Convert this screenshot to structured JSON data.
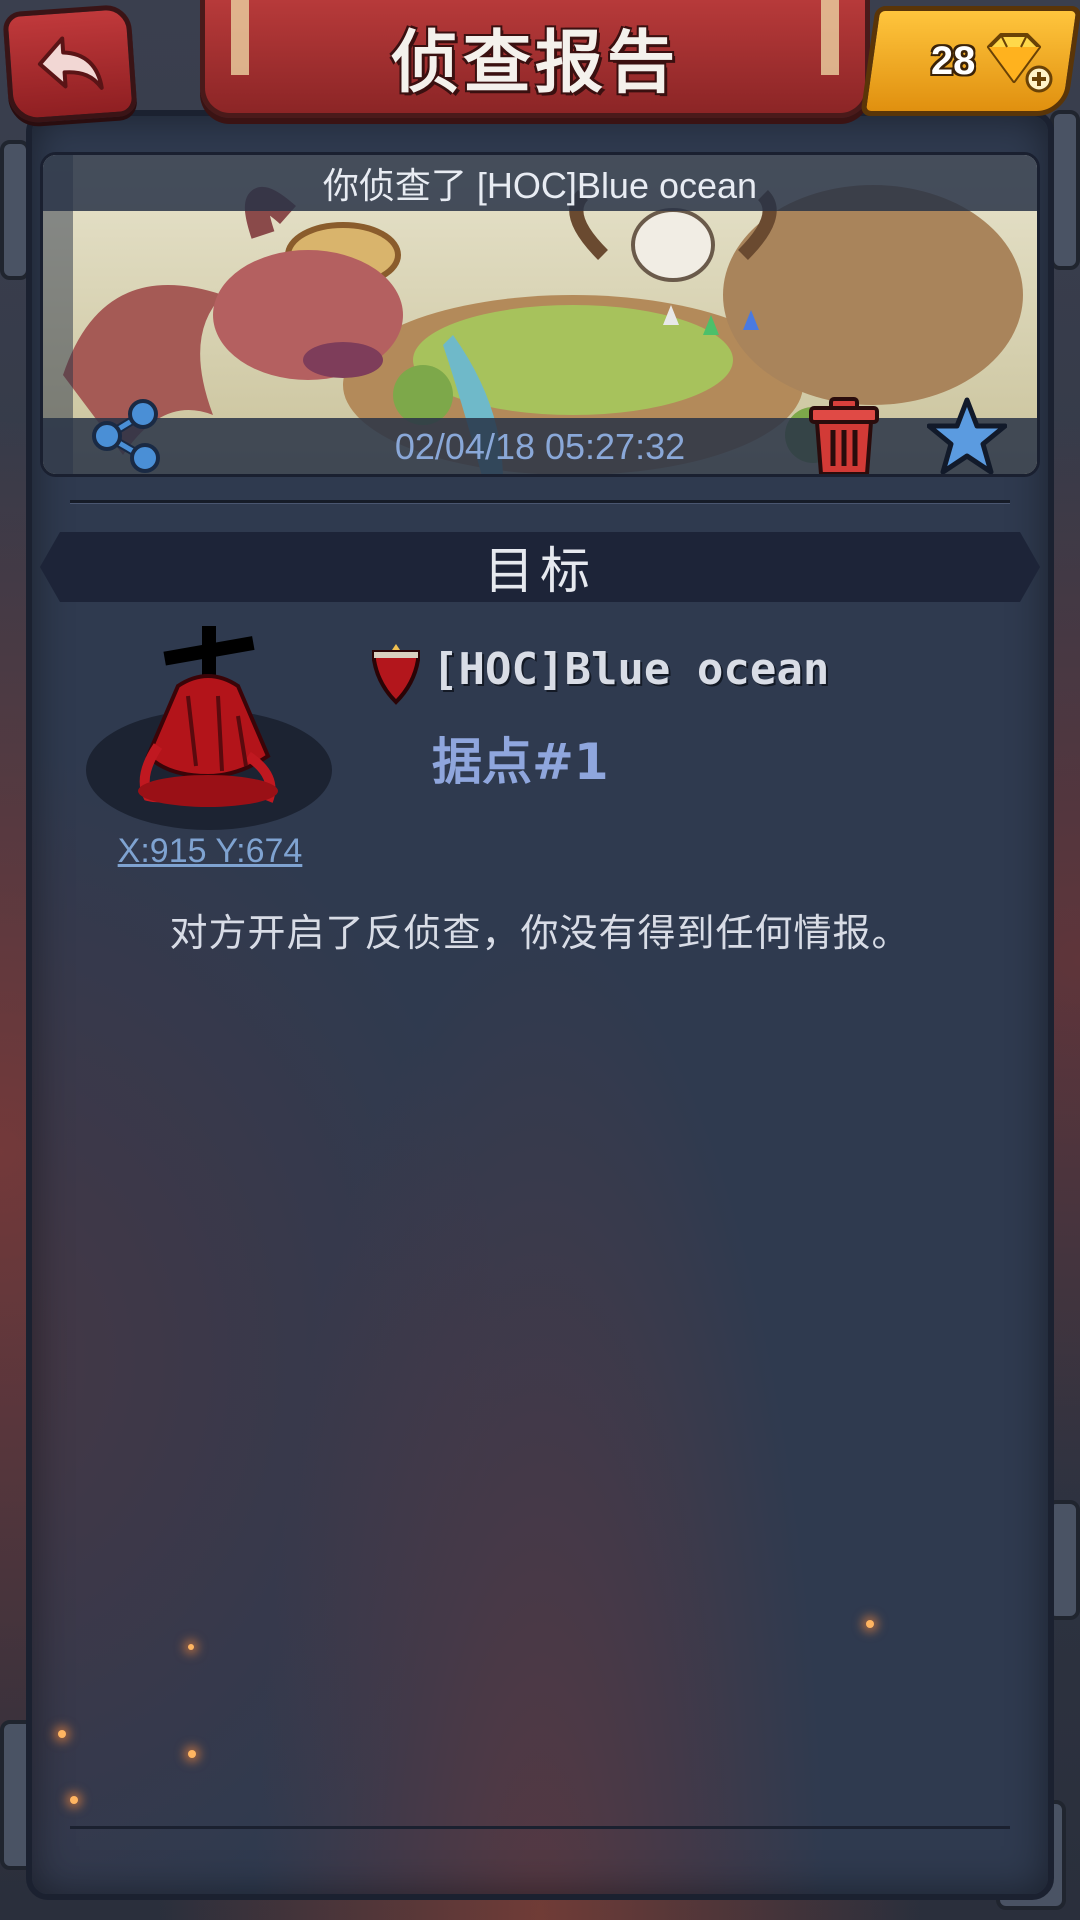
{
  "header": {
    "title": "侦查报告",
    "gems": "28"
  },
  "report": {
    "subject": "你侦查了 [HOC]Blue ocean",
    "timestamp": "02/04/18 05:27:32"
  },
  "section": {
    "title": "目标"
  },
  "target": {
    "name": "[HOC]Blue ocean",
    "place": "据点#1",
    "coords": "X:915 Y:674",
    "result": "对方开启了反侦查，你没有得到任何情报。"
  },
  "colors": {
    "accent_red": "#b73a3a",
    "gem_gold": "#ffc53d",
    "panel_bg": "#2f3a4f",
    "link_blue": "#7fa3d1",
    "place_blue": "#8fa6dd"
  },
  "icons": {
    "back": "back-arrow-icon",
    "gem": "diamond-plus-icon",
    "share": "share-icon",
    "delete": "trash-icon",
    "favorite": "star-icon",
    "alliance": "alliance-banner-icon"
  }
}
